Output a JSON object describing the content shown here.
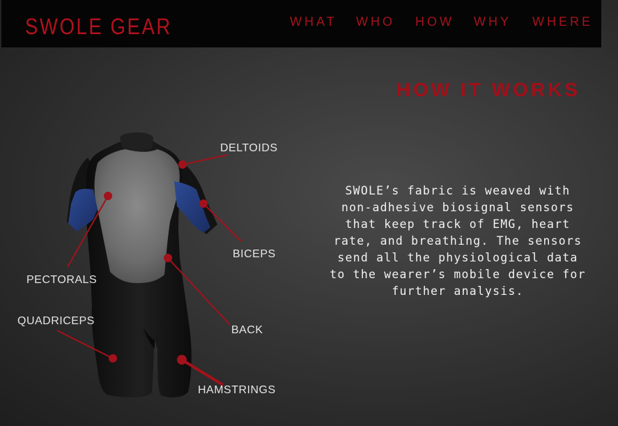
{
  "header": {
    "brand": "SWOLE GEAR",
    "nav": [
      "WHAT",
      "WHO",
      "HOW",
      "WHY",
      "WHERE"
    ]
  },
  "section": {
    "title": "HOW IT WORKS",
    "description": "SWOLE’s fabric is weaved with non-adhesive biosignal sensors that keep track of EMG, heart rate, and breathing. The sensors send all the physiological data to the wearer’s mobile device for further analysis."
  },
  "diagram": {
    "labels": {
      "deltoids": "DELTOIDS",
      "biceps": "BICEPS",
      "pectorals": "PECTORALS",
      "back": "BACK",
      "quadriceps": "QUADRICEPS",
      "hamstrings": "HAMSTRINGS"
    }
  },
  "colors": {
    "accent": "#a5131d",
    "navbar_bg": "#050505",
    "page_bg": "#353535",
    "suit_black": "#151515",
    "suit_gray": "#777777",
    "suit_blue": "#223a7a"
  }
}
